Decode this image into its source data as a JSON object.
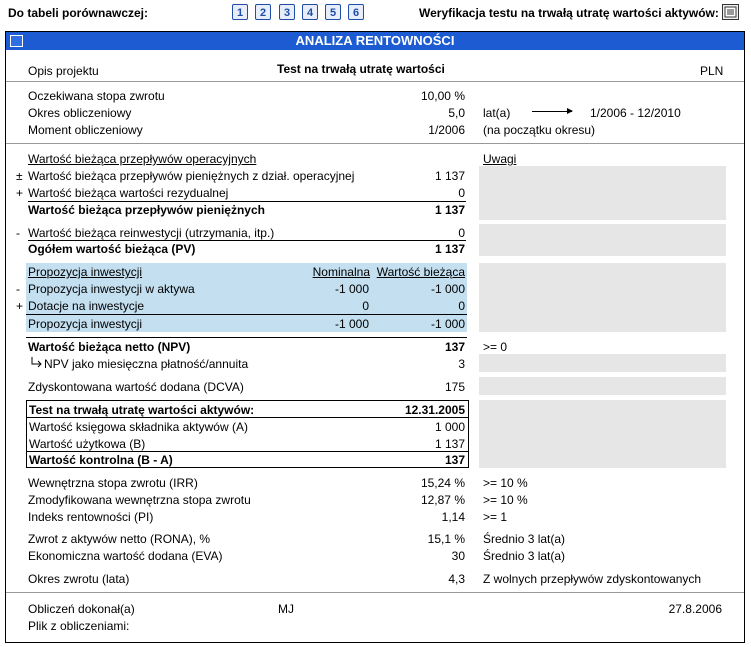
{
  "topbar": {
    "compare_label": "Do tabeli porównawczej:",
    "tabs": [
      "1",
      "2",
      "3",
      "4",
      "5",
      "6"
    ],
    "verify_label": "Weryfikacja testu na trwałą utratę wartości aktywów:"
  },
  "panel": {
    "title": "ANALIZA RENTOWNOŚCI",
    "project_label": "Opis projektu",
    "project_name": "Test na trwałą utratę wartości",
    "currency": "PLN"
  },
  "params": {
    "rate_label": "Oczekiwana stopa zwrotu",
    "rate_value": "10,00 %",
    "period_label": "Okres obliczeniowy",
    "period_value": "5,0",
    "period_unit": "lat(a)",
    "period_range": "1/2006 - 12/2010",
    "moment_label": "Moment obliczeniowy",
    "moment_value": "1/2006",
    "moment_note": "(na początku okresu)"
  },
  "pv": {
    "section_title": "Wartość bieżąca przepływów operacyjnych",
    "notes_title": "Uwagi",
    "rows": [
      {
        "sign": "±",
        "label": "Wartość bieżąca przepływów pieniężnych z dział. operacyjnej",
        "value": "1 137"
      },
      {
        "sign": "+",
        "label": "Wartość bieżąca wartości rezydualnej",
        "value": "0"
      }
    ],
    "total_label": "Wartość bieżąca przepływów pieniężnych",
    "total_value": "1 137",
    "reinv_sign": "-",
    "reinv_label": "Wartość bieżąca reinwestycji (utrzymania, itp.)",
    "reinv_value": "0",
    "grand_label": "Ogółem wartość bieżąca (PV)",
    "grand_value": "1 137"
  },
  "investment": {
    "header_label": "Propozycja inwestycji",
    "col_nominal": "Nominalna",
    "col_present": "Wartość bieżąca",
    "rows": [
      {
        "sign": "-",
        "label": "Propozycja inwestycji w aktywa",
        "nominal": "-1 000",
        "present": "-1 000"
      },
      {
        "sign": "+",
        "label": "Dotacje na inwestycje",
        "nominal": "0",
        "present": "0"
      }
    ],
    "total_label": "Propozycja inwestycji",
    "total_nominal": "-1 000",
    "total_present": "-1 000"
  },
  "npv": {
    "label": "Wartość bieżąca netto (NPV)",
    "value": "137",
    "note": ">= 0",
    "annuity_label": "NPV jako miesięczna płatność/annuita",
    "annuity_value": "3",
    "dcva_label": "Zdyskontowana wartość dodana (DCVA)",
    "dcva_value": "175"
  },
  "impairment": {
    "title": "Test na trwałą utratę wartości aktywów:",
    "date": "12.31.2005",
    "book_label": "Wartość księgowa składnika aktywów (A)",
    "book_value": "1 000",
    "use_label": "Wartość użytkowa (B)",
    "use_value": "1 137",
    "control_label": "Wartość kontrolna (B - A)",
    "control_value": "137"
  },
  "metrics": [
    {
      "label": "Wewnętrzna stopa zwrotu (IRR)",
      "value": "15,24 %",
      "note": ">= 10 %"
    },
    {
      "label": "Zmodyfikowana wewnętrzna stopa zwrotu",
      "value": "12,87 %",
      "note": ">= 10 %"
    },
    {
      "label": "Indeks rentowności (PI)",
      "value": "1,14",
      "note": ">= 1"
    },
    {
      "label": "Zwrot z aktywów netto (RONA), %",
      "value": "15,1 %",
      "note": "Średnio 3 lat(a)"
    },
    {
      "label": "Ekonomiczna wartość dodana (EVA)",
      "value": "30",
      "note": "Średnio 3 lat(a)"
    },
    {
      "label": "Okres zwrotu (lata)",
      "value": "4,3",
      "note": "Z wolnych przepływów zdyskontowanych"
    }
  ],
  "footer": {
    "author_label": "Obliczeń dokonał(a)",
    "author": "MJ",
    "date": "27.8.2006",
    "file_label": "Plik z obliczeniami:"
  },
  "colors": {
    "title_bar": "#1c5bd1",
    "investment_bg": "#c3dff0",
    "notes_bg": "#e6e6e6",
    "tab_border": "#1f4ea8"
  }
}
